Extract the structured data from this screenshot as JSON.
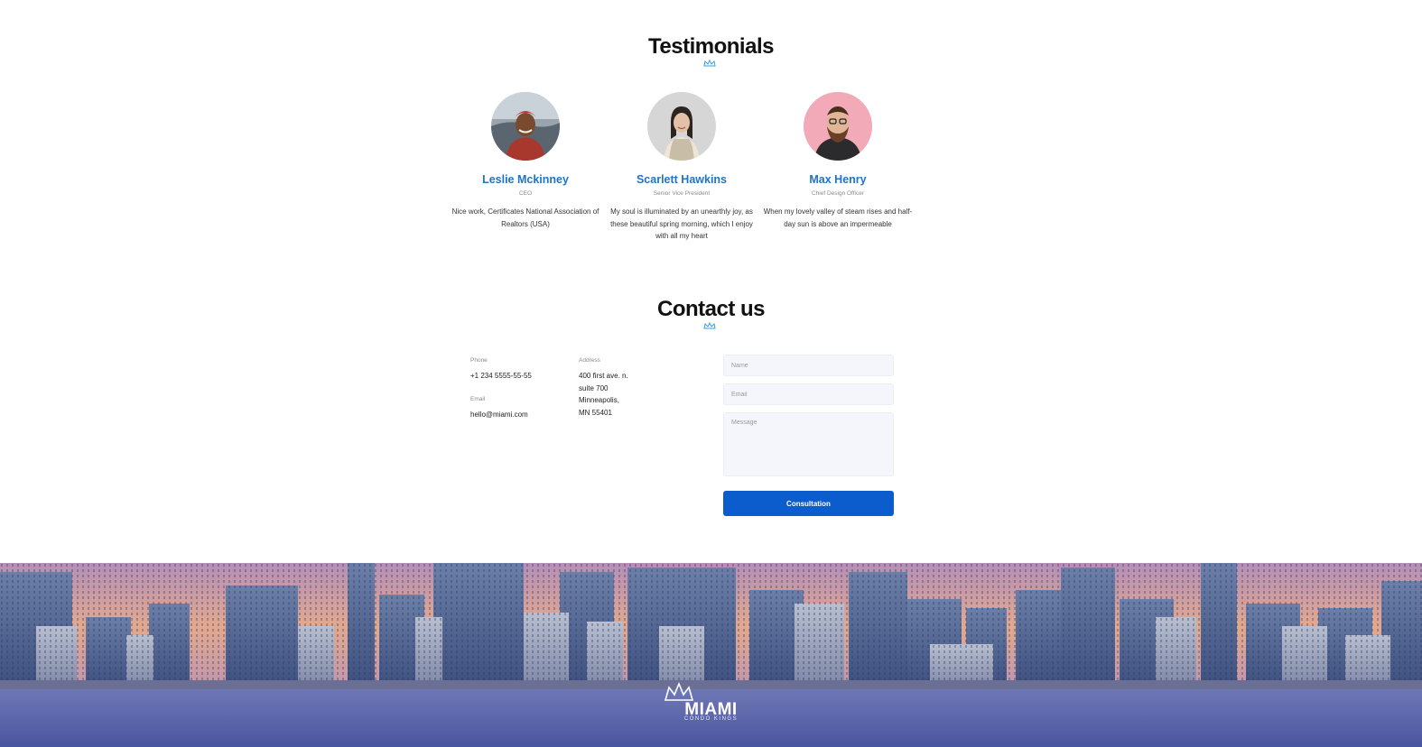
{
  "testimonials": {
    "title": "Testimonials",
    "items": [
      {
        "name": "Leslie Mckinney",
        "role": "CEO",
        "quote": "Nice work, Certificates National Association of Realtors (USA)"
      },
      {
        "name": "Scarlett Hawkins",
        "role": "Senior Vice President",
        "quote": "My soul is illuminated by an unearthly joy, as these beautiful spring morning, which I enjoy with all my heart"
      },
      {
        "name": "Max Henry",
        "role": "Chief Design Officer",
        "quote": "When my lovely valley of steam rises and half-day sun is above an impermeable"
      }
    ]
  },
  "contact": {
    "title": "Contact us",
    "phone_label": "Phone",
    "phone": "+1 234 5555-55-55",
    "email_label": "Email",
    "email": "hello@miami.com",
    "address_label": "Address",
    "address_lines": [
      "400 first ave. n.",
      "suite 700",
      "Minneapolis,",
      "MN 55401"
    ],
    "form": {
      "name_placeholder": "Name",
      "email_placeholder": "Email",
      "message_placeholder": "Message",
      "submit_label": "Consultation"
    }
  },
  "footer": {
    "logo_main": "MIAMI",
    "logo_sub": "CONDO KINGS"
  },
  "colors": {
    "accent": "#1d74c9",
    "button": "#0b5ccc",
    "crown_mark": "#3aa0e0"
  }
}
